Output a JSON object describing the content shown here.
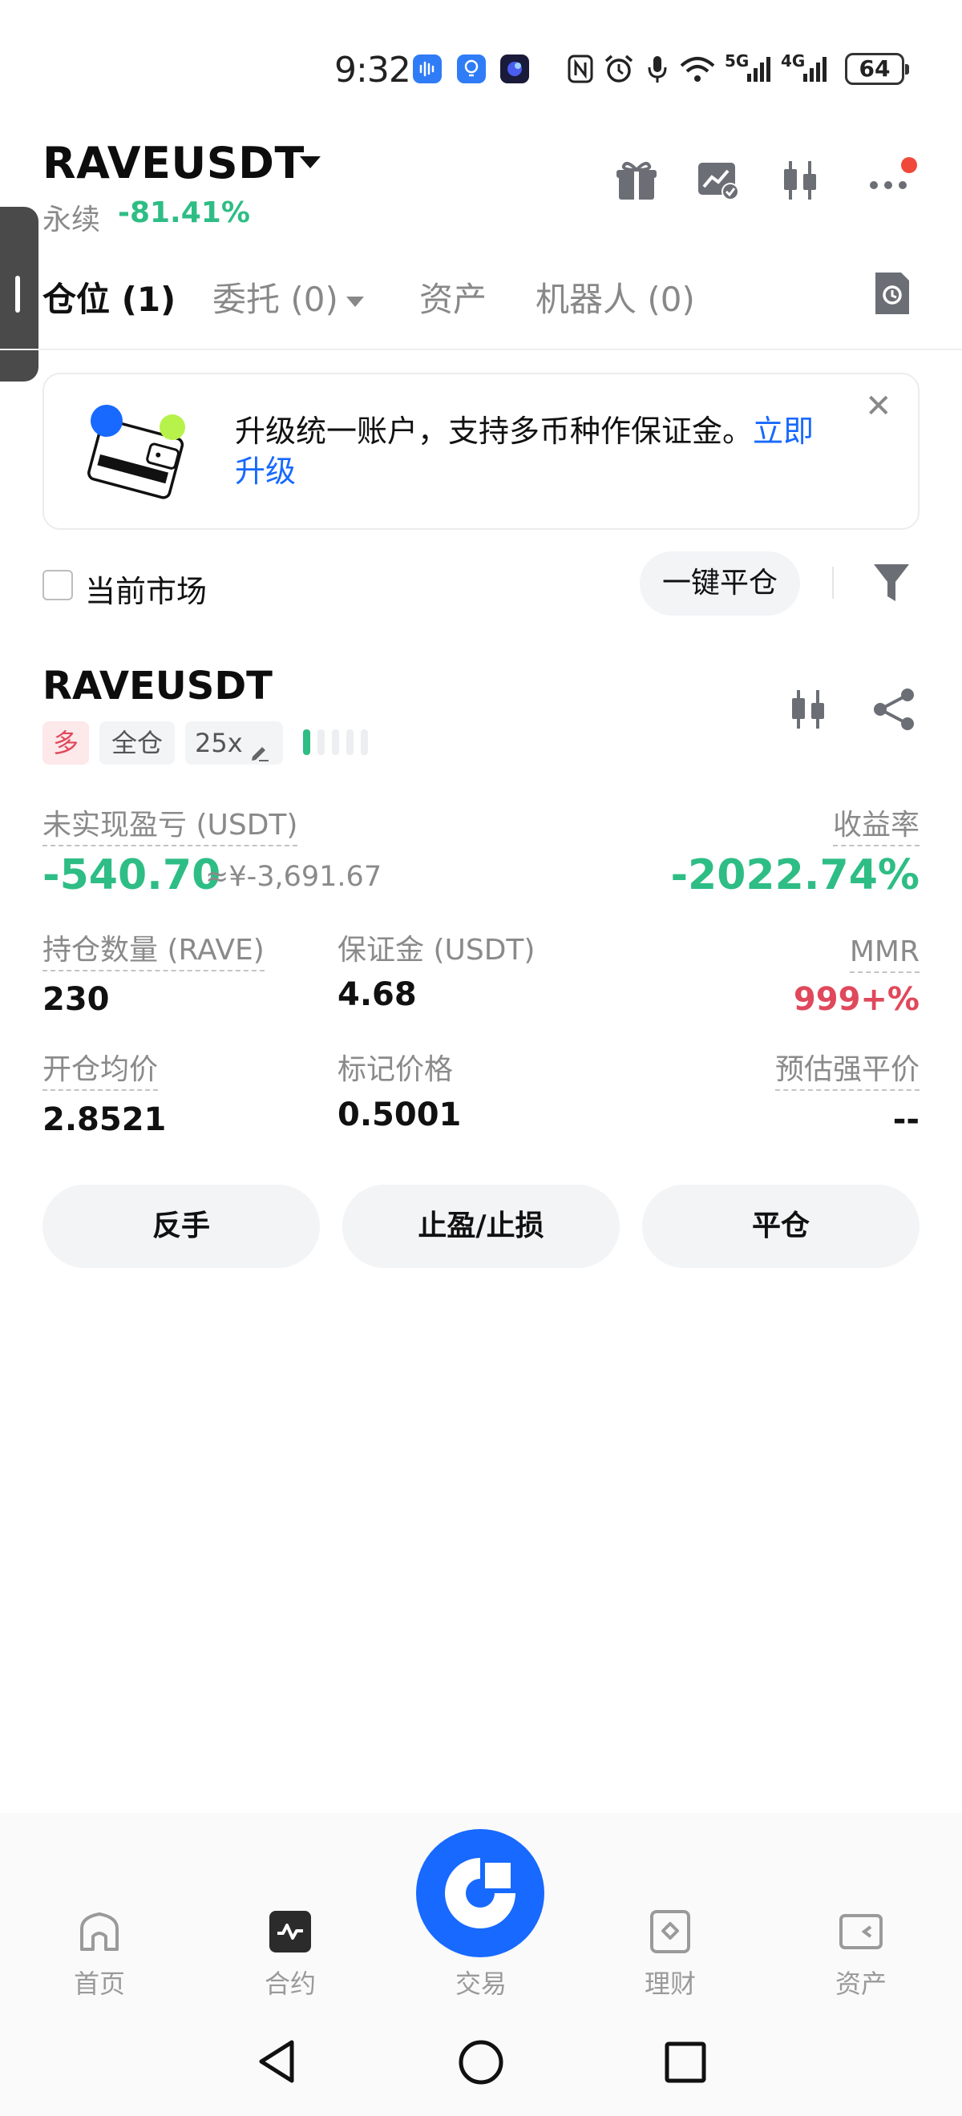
{
  "status_bar": {
    "time": "9:32",
    "network_5g": "5G",
    "network_4g": "4G",
    "battery": "64"
  },
  "header": {
    "symbol": "RAVEUSDT",
    "contract_type": "永续",
    "change_pct": "-81.41%",
    "icons": [
      "gift-icon",
      "chart-check-icon",
      "candlestick-icon",
      "more-icon"
    ]
  },
  "tabs": [
    {
      "label": "仓位 (1)",
      "active": true
    },
    {
      "label": "委托 (0)",
      "active": false
    },
    {
      "label": "资产",
      "active": false
    },
    {
      "label": "机器人 (0)",
      "active": false
    }
  ],
  "banner": {
    "text": "升级统一账户，支持多币种作保证金。",
    "link": "立即升级"
  },
  "filters": {
    "current_market_label": "当前市场",
    "close_all_label": "一键平仓"
  },
  "position": {
    "symbol": "RAVEUSDT",
    "side": "多",
    "margin_mode": "全仓",
    "leverage": "25x",
    "risk_level": 0.2,
    "unrealized_pnl_label": "未实现盈亏 (USDT)",
    "unrealized_pnl": "-540.70",
    "unrealized_pnl_cny": "≈¥-3,691.67",
    "roe_label": "收益率",
    "roe": "-2022.74%",
    "size_label": "持仓数量 (RAVE)",
    "size": "230",
    "margin_label": "保证金 (USDT)",
    "margin": "4.68",
    "mmr_label": "MMR",
    "mmr": "999+%",
    "entry_price_label": "开仓均价",
    "entry_price": "2.8521",
    "mark_price_label": "标记价格",
    "mark_price": "0.5001",
    "liq_price_label": "预估强平价",
    "liq_price": "--",
    "actions": [
      "反手",
      "止盈/止损",
      "平仓"
    ]
  },
  "bottom_nav": [
    {
      "label": "首页",
      "icon": "home-icon"
    },
    {
      "label": "合约",
      "icon": "futures-icon"
    },
    {
      "label": "交易",
      "icon": "trade-icon"
    },
    {
      "label": "理财",
      "icon": "earn-icon"
    },
    {
      "label": "资产",
      "icon": "wallet-icon"
    }
  ],
  "colors": {
    "green": "#2ebd85",
    "red": "#e0485b",
    "accent": "#1769ff"
  }
}
